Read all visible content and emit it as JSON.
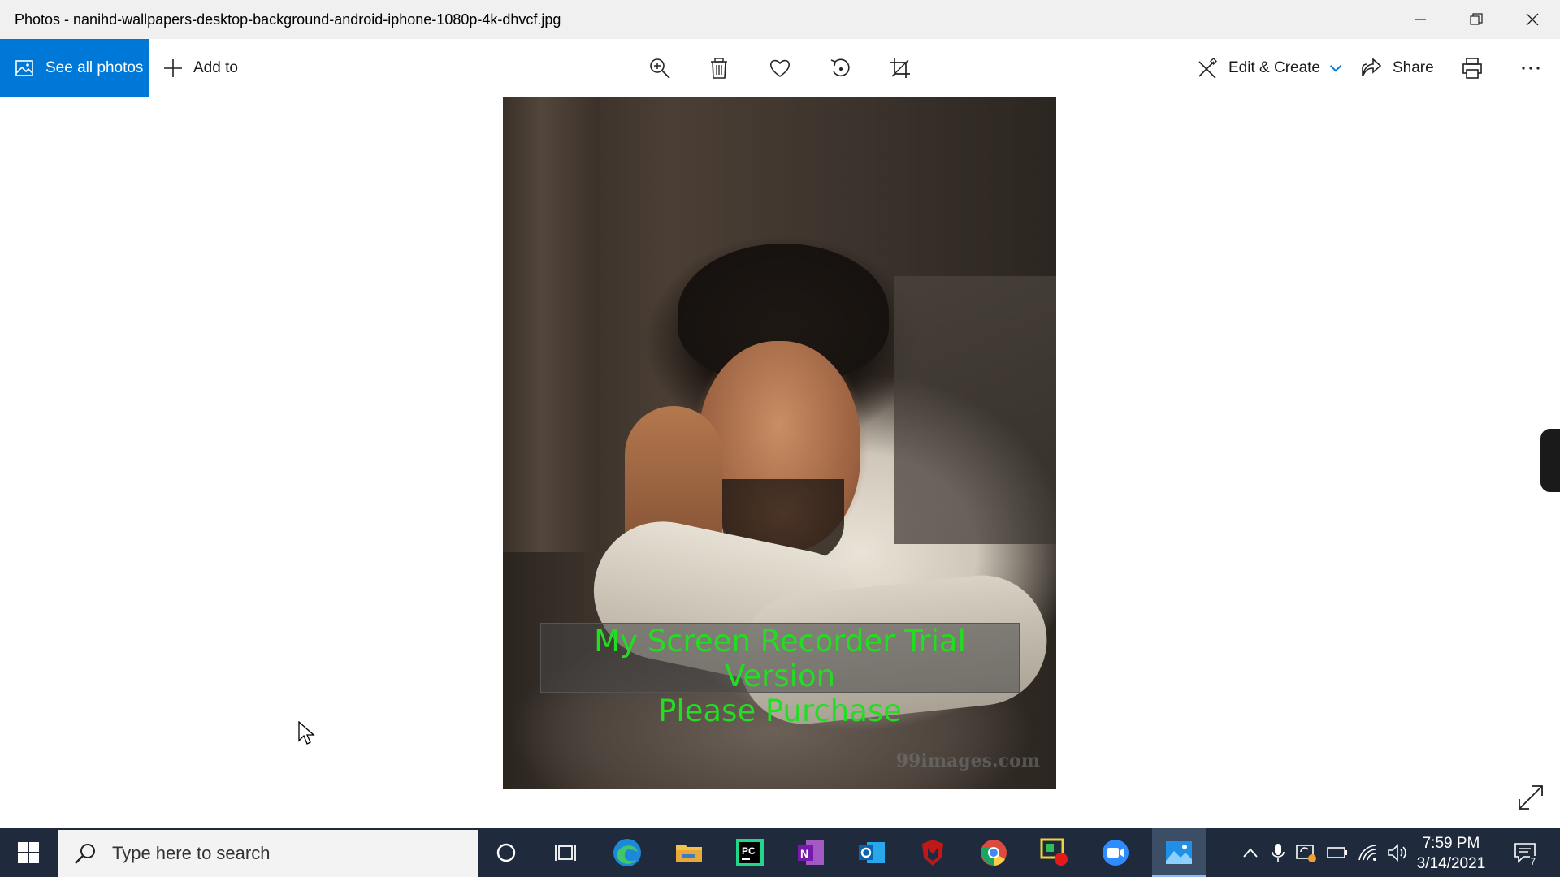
{
  "window": {
    "title": "Photos - nanihd-wallpapers-desktop-background-android-iphone-1080p-4k-dhvcf.jpg",
    "controls": [
      "minimize-icon",
      "restore-icon",
      "close-icon"
    ]
  },
  "toolbar": {
    "see_all_label": "See all photos",
    "add_to_label": "Add to",
    "tools": [
      "zoom-in-icon",
      "delete-icon",
      "favorite-heart-icon",
      "rotate-icon",
      "crop-icon"
    ],
    "edit_create_label": "Edit & Create",
    "share_label": "Share",
    "print_icon": "print-icon",
    "more_icon": "more-ellipsis-icon",
    "accent": "#0078d7"
  },
  "photo": {
    "watermark_line1": "My Screen Recorder Trial Version",
    "watermark_line2": "Please Purchase",
    "watermark_color": "#22dd22",
    "site_mark": "99images.com"
  },
  "taskbar": {
    "search_placeholder": "Type here to search",
    "apps": [
      "cortana",
      "task-view",
      "edge",
      "file-explorer",
      "pycharm",
      "onenote",
      "outlook",
      "mcafee",
      "chrome",
      "recorder",
      "zoom",
      "photos"
    ],
    "time": "7:59 PM",
    "date": "3/14/2021",
    "notification_count": "7",
    "background": "#1f2b3d"
  }
}
